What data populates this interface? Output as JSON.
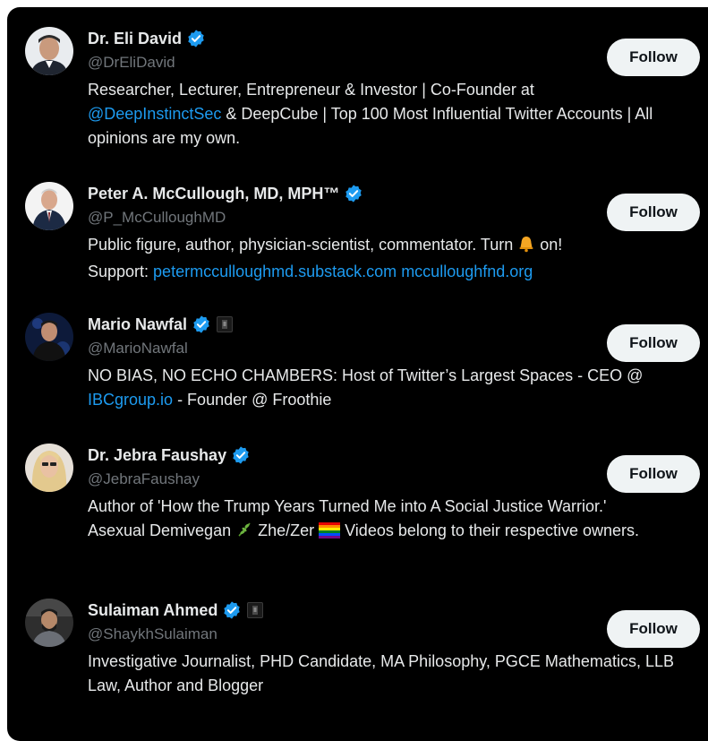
{
  "colors": {
    "background": "#000000",
    "text": "#e7e9ea",
    "secondary_text": "#71767b",
    "link": "#1d9bf0",
    "verified_badge": "#1d9bf0",
    "follow_button_bg": "#eff3f4"
  },
  "users": [
    {
      "name": "Dr. Eli David",
      "handle": "@DrEliDavid",
      "verified": true,
      "bio_parts": {
        "p1": "Researcher, Lecturer, Entrepreneur & Investor | Co-Founder at",
        "link1": "@DeepInstinctSec",
        "p2": " & DeepCube | Top 100 Most Influential Twitter Accounts | All opinions are my own."
      },
      "follow_label": "Follow"
    },
    {
      "name": "Peter A. McCullough, MD, MPH™",
      "handle": "@P_McCulloughMD",
      "verified": true,
      "bio_parts": {
        "p1": "Public figure, author, physician-scientist, commentator. Turn ",
        "emoji1": "bell-emoji",
        "p2": " on!",
        "p3": "Support: ",
        "link1": "petermcculloughmd.substack.com",
        "link2": "mcculloughfnd.org"
      },
      "follow_label": "Follow"
    },
    {
      "name": "Mario Nawfal",
      "handle": "@MarioNawfal",
      "verified": true,
      "affiliate_badge": true,
      "bio_parts": {
        "p1": "NO BIAS, NO ECHO CHAMBERS: Host of Twitter’s Largest Spaces - CEO @",
        "link1": "IBCgroup.io",
        "p2": " - Founder @ Froothie"
      },
      "follow_label": "Follow"
    },
    {
      "name": "Dr. Jebra Faushay",
      "handle": "@JebraFaushay",
      "verified": true,
      "bio_parts": {
        "p1": "Author of 'How the Trump Years Turned Me into A Social Justice Warrior.'",
        "p2": "Asexual Demivegan ",
        "emoji1": "herb-emoji",
        "p3": " Zhe/Zer ",
        "emoji2": "rainbow-flag-emoji",
        "p4": " Videos belong to their respective owners."
      },
      "follow_label": "Follow"
    },
    {
      "name": "Sulaiman Ahmed",
      "handle": "@ShaykhSulaiman",
      "verified": true,
      "affiliate_badge": true,
      "bio_parts": {
        "p1": "Investigative Journalist, PHD Candidate, MA Philosophy, PGCE Mathematics, LLB Law, Author and Blogger"
      },
      "follow_label": "Follow"
    }
  ]
}
